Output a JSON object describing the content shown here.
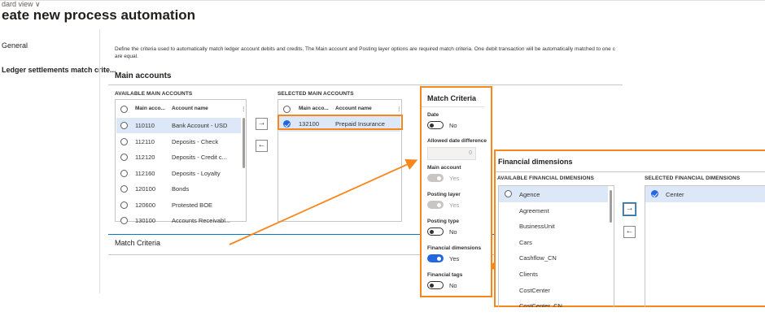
{
  "header": {
    "view_label": "dard view ∨",
    "title": "eate new process automation"
  },
  "nav": {
    "items": [
      {
        "label": "General"
      },
      {
        "label": "Ledger settlements match crite..."
      }
    ]
  },
  "description": "Define the criteria used to automatically match ledger account debits and credits. The Main account and Posting layer options are required match criteria. One debit transaction will be automatically matched to one c are equal.",
  "main_accounts": {
    "section_title": "Main accounts",
    "available": {
      "header": "AVAILABLE MAIN ACCOUNTS",
      "col_main": "Main acco...",
      "col_name": "Account name",
      "rows": [
        {
          "account": "110110",
          "name": "Bank Account - USD",
          "selected": true
        },
        {
          "account": "112110",
          "name": "Deposits - Check",
          "selected": false
        },
        {
          "account": "112120",
          "name": "Deposits - Credit c...",
          "selected": false
        },
        {
          "account": "112160",
          "name": "Deposits - Loyalty",
          "selected": false
        },
        {
          "account": "120100",
          "name": "Bonds",
          "selected": false
        },
        {
          "account": "120600",
          "name": "Protested BOE",
          "selected": false
        },
        {
          "account": "130100",
          "name": "Accounts Receivabl...",
          "selected": false
        }
      ]
    },
    "add_glyph": "→",
    "remove_glyph": "←",
    "selected": {
      "header": "SELECTED MAIN ACCOUNTS",
      "col_main": "Main acco...",
      "col_name": "Account name",
      "rows": [
        {
          "account": "132100",
          "name": "Prepaid Insurance",
          "selected": true
        }
      ]
    }
  },
  "match_criteria_collapsed": {
    "label": "Match Criteria"
  },
  "match_criteria_panel": {
    "title": "Match Criteria",
    "fields": [
      {
        "label": "Date",
        "type": "toggle",
        "value": "No",
        "on": false,
        "disabled": false
      },
      {
        "label": "Allowed date difference",
        "type": "number",
        "value": "0"
      },
      {
        "label": "Main account",
        "type": "toggle",
        "value": "Yes",
        "on": true,
        "disabled": true
      },
      {
        "label": "Posting layer",
        "type": "toggle",
        "value": "Yes",
        "on": true,
        "disabled": true
      },
      {
        "label": "Posting type",
        "type": "toggle",
        "value": "No",
        "on": false,
        "disabled": false
      },
      {
        "label": "Financial dimensions",
        "type": "toggle",
        "value": "Yes",
        "on": true,
        "disabled": false
      },
      {
        "label": "Financial tags",
        "type": "toggle",
        "value": "No",
        "on": false,
        "disabled": false
      }
    ]
  },
  "financial_dimensions": {
    "title": "Financial dimensions",
    "available_header": "AVAILABLE FINANCIAL DIMENSIONS",
    "selected_header": "SELECTED FINANCIAL DIMENSIONS",
    "available": [
      {
        "label": "Agence",
        "selected": true
      },
      {
        "label": "Agreement",
        "selected": false
      },
      {
        "label": "BusinessUnit",
        "selected": false
      },
      {
        "label": "Cars",
        "selected": false
      },
      {
        "label": "Cashflow_CN",
        "selected": false
      },
      {
        "label": "Clients",
        "selected": false
      },
      {
        "label": "CostCenter",
        "selected": false
      },
      {
        "label": "CostCenter_CN",
        "selected": false
      }
    ],
    "selected": [
      {
        "label": "Center",
        "selected": true
      }
    ],
    "add_glyph": "→",
    "remove_glyph": "←"
  },
  "colors": {
    "callout": "#f7861b",
    "accent": "#2266e3",
    "selection": "#dce8f7"
  }
}
